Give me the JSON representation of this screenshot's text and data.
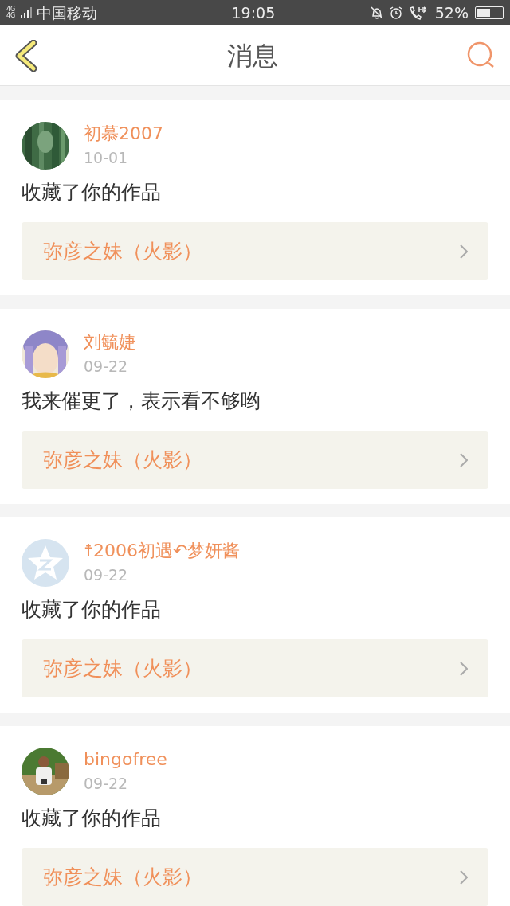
{
  "status_bar": {
    "carrier": "中国移动",
    "network": "4G 4G",
    "time": "19:05",
    "battery_text": "52%"
  },
  "header": {
    "title": "消息"
  },
  "messages": [
    {
      "user": "初慕2007",
      "date": "10-01",
      "text": "收藏了你的作品",
      "work": "弥彦之妹（火影）"
    },
    {
      "user": "刘毓婕",
      "date": "09-22",
      "text": "我来催更了，表示看不够哟",
      "work": "弥彦之妹（火影）"
    },
    {
      "avatar": {
        "kind": "default"
      },
      "user": "☨2006初遇↶梦妍酱",
      "date": "09-22",
      "text": "收藏了你的作品",
      "work": "弥彦之妹（火影）"
    },
    {
      "user": "bingofree",
      "date": "09-22",
      "text": "收藏了你的作品",
      "work": "弥彦之妹（火影）"
    }
  ]
}
